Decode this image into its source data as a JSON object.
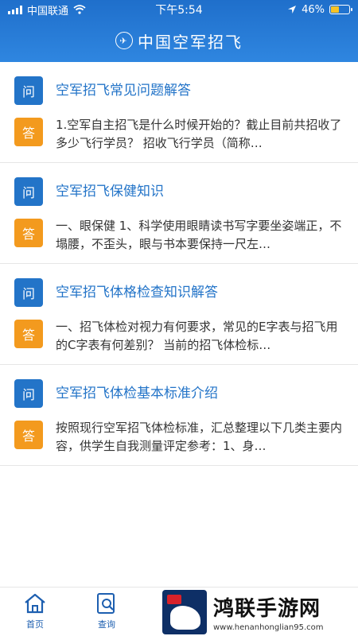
{
  "status": {
    "carrier": "中国联通",
    "time": "下午5:54",
    "battery": "46%",
    "battery_level": 0.46
  },
  "header": {
    "title": "中国空军招飞"
  },
  "qa_list": [
    {
      "question_badge": "问",
      "question": "空军招飞常见问题解答",
      "answer_badge": "答",
      "answer": "1.空军自主招飞是什么时候开始的？截止目前共招收了多少飞行学员？ 招收飞行学员（简称…"
    },
    {
      "question_badge": "问",
      "question": "空军招飞保健知识",
      "answer_badge": "答",
      "answer": "一、眼保健 1、科学使用眼睛读书写字要坐姿端正，不塌腰，不歪头，眼与书本要保持一尺左…"
    },
    {
      "question_badge": "问",
      "question": "空军招飞体格检查知识解答",
      "answer_badge": "答",
      "answer": "一、招飞体检对视力有何要求，常见的E字表与招飞用的C字表有何差别？ 当前的招飞体检标…"
    },
    {
      "question_badge": "问",
      "question": "空军招飞体检基本标准介绍",
      "answer_badge": "答",
      "answer": "按照现行空军招飞体检标准，汇总整理以下几类主要内容，供学生自我测量评定参考：1、身…"
    }
  ],
  "tabbar": {
    "home_label": "首页",
    "search_label": "查询"
  },
  "watermark": {
    "title": "鸿联手游网",
    "url": "www.henanhonglian95.com"
  }
}
